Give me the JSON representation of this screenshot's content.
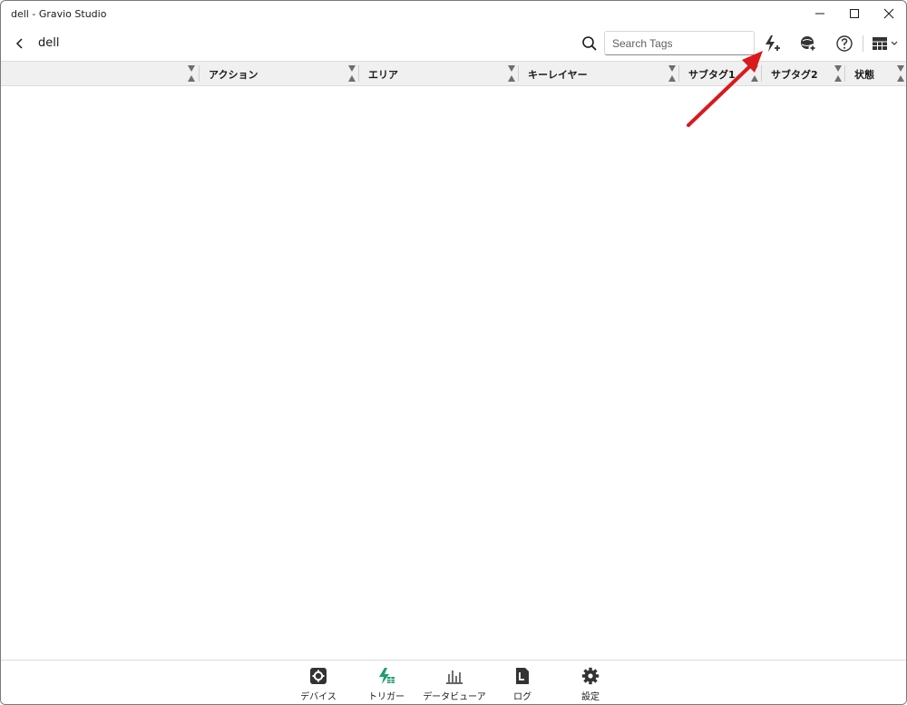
{
  "window": {
    "title": "dell - Gravio Studio"
  },
  "header": {
    "page_title": "dell",
    "search_placeholder": "Search Tags",
    "search_value": ""
  },
  "table": {
    "columns": [
      "",
      "アクション",
      "エリア",
      "キーレイヤー",
      "サブタグ1",
      "サブタグ2",
      "状態"
    ],
    "rows": []
  },
  "bottom_nav": {
    "items": [
      {
        "label": "デバイス",
        "icon": "device-gear-icon"
      },
      {
        "label": "トリガー",
        "icon": "trigger-bolt-icon",
        "active": true
      },
      {
        "label": "データビューア",
        "icon": "bar-chart-icon"
      },
      {
        "label": "ログ",
        "icon": "log-document-icon"
      },
      {
        "label": "設定",
        "icon": "settings-gear-icon"
      }
    ]
  },
  "colors": {
    "accent_green": "#1f9e6e",
    "annotation_red": "#d9191c",
    "icon_dark": "#333333"
  }
}
